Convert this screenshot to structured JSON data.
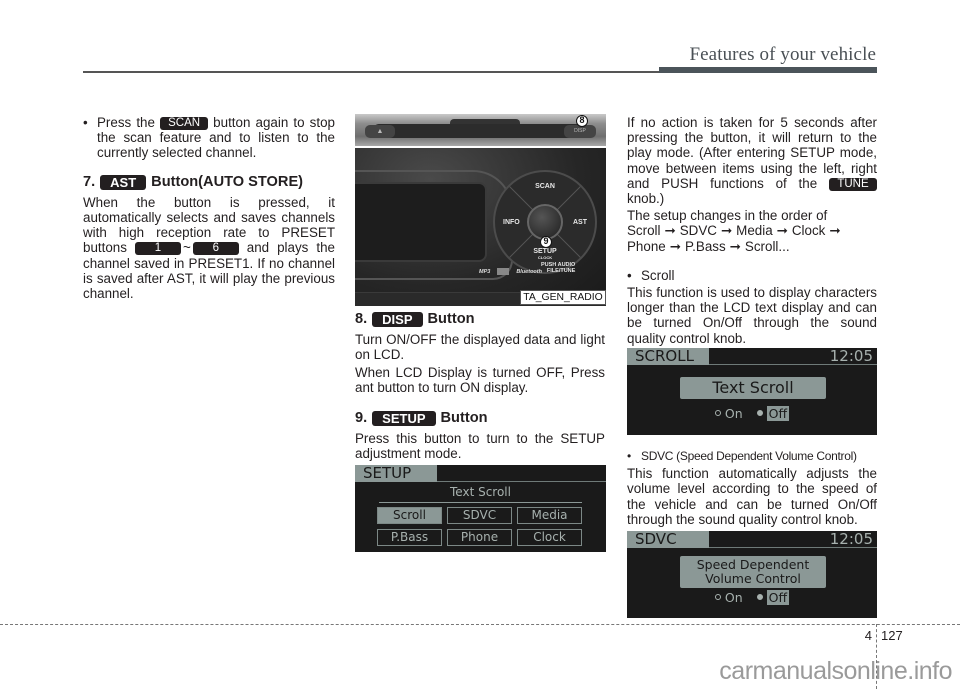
{
  "header": {
    "section_title": "Features of your vehicle"
  },
  "column1": {
    "intro_bullet": {
      "before": "Press the",
      "key": "SCAN",
      "after": "button again to stop the scan feature and to listen to the currently selected channel."
    },
    "section7": {
      "number": "7.",
      "key": "AST",
      "title": "Button(AUTO STORE)",
      "para_before": "When the button is pressed, it automatically selects and saves channels with high reception rate to PRESET buttons",
      "preset_from": "1",
      "tilde": "~",
      "preset_to": "6",
      "para_after": "and plays the channel saved in PRESET1. If no channel is saved after AST, it will play the previous channel."
    }
  },
  "radio_photo": {
    "eject": "▲",
    "disp": "DISP",
    "callout_8": "8",
    "callout_9": "9",
    "dial": {
      "top": "SCAN",
      "left": "INFO",
      "right": "AST",
      "bottom": "SETUP",
      "bottom_sub": "CLOCK"
    },
    "brand_mp3": "MP3",
    "brand_bt": "Bluetooth",
    "push_audio": "PUSH AUDIO",
    "file_tune": "FILE/TUNE",
    "caption": "TA_GEN_RADIO"
  },
  "column2": {
    "section8": {
      "number": "8.",
      "key": "DISP",
      "title": "Button",
      "para1": "Turn ON/OFF the displayed data and light on LCD.",
      "para2": "When LCD Display is turned OFF, Press ant button to turn ON display."
    },
    "section9": {
      "number": "9.",
      "key": "SETUP",
      "title": "Button",
      "para1": "Press this button to turn to the SETUP adjustment mode."
    },
    "setup_screen": {
      "tab": "SETUP",
      "subtitle": "Text Scroll",
      "options": [
        {
          "label": "Scroll",
          "selected": true
        },
        {
          "label": "SDVC",
          "selected": false
        },
        {
          "label": "Media",
          "selected": false
        },
        {
          "label": "P.Bass",
          "selected": false
        },
        {
          "label": "Phone",
          "selected": false
        },
        {
          "label": "Clock",
          "selected": false
        }
      ]
    }
  },
  "column3": {
    "para1_before": "If no action is taken for 5 seconds after pressing the button, it will return to the play mode. (After entering SETUP mode, move between items using the left, right and PUSH functions of the",
    "tune_key": "TUNE",
    "para1_after": "knob.)",
    "order_intro": "The setup changes in the order of",
    "order": [
      "Scroll",
      "SDVC",
      "Media",
      "Clock",
      "Phone",
      "P.Bass",
      "Scroll..."
    ],
    "arrow": "➞",
    "scroll": {
      "bullet": "Scroll",
      "para": "This function is used to display characters longer than the LCD text display and can be turned On/Off through the sound quality control knob.",
      "screen": {
        "tab": "SCROLL",
        "clock": "12:05",
        "box": "Text Scroll",
        "on": "On",
        "off": "Off",
        "value": "Off"
      }
    },
    "sdvc": {
      "bullet": "SDVC (Speed Dependent Volume Control)",
      "para": "This function automatically adjusts the volume level according to the speed of the vehicle and can be turned On/Off through the sound quality control knob.",
      "screen": {
        "tab": "SDVC",
        "clock": "12:05",
        "box_line1": "Speed Dependent",
        "box_line2": "Volume Control",
        "on": "On",
        "off": "Off",
        "value": "Off"
      }
    }
  },
  "footer": {
    "chapter": "4",
    "page": "127",
    "watermark": "carmanualsonline.info"
  }
}
